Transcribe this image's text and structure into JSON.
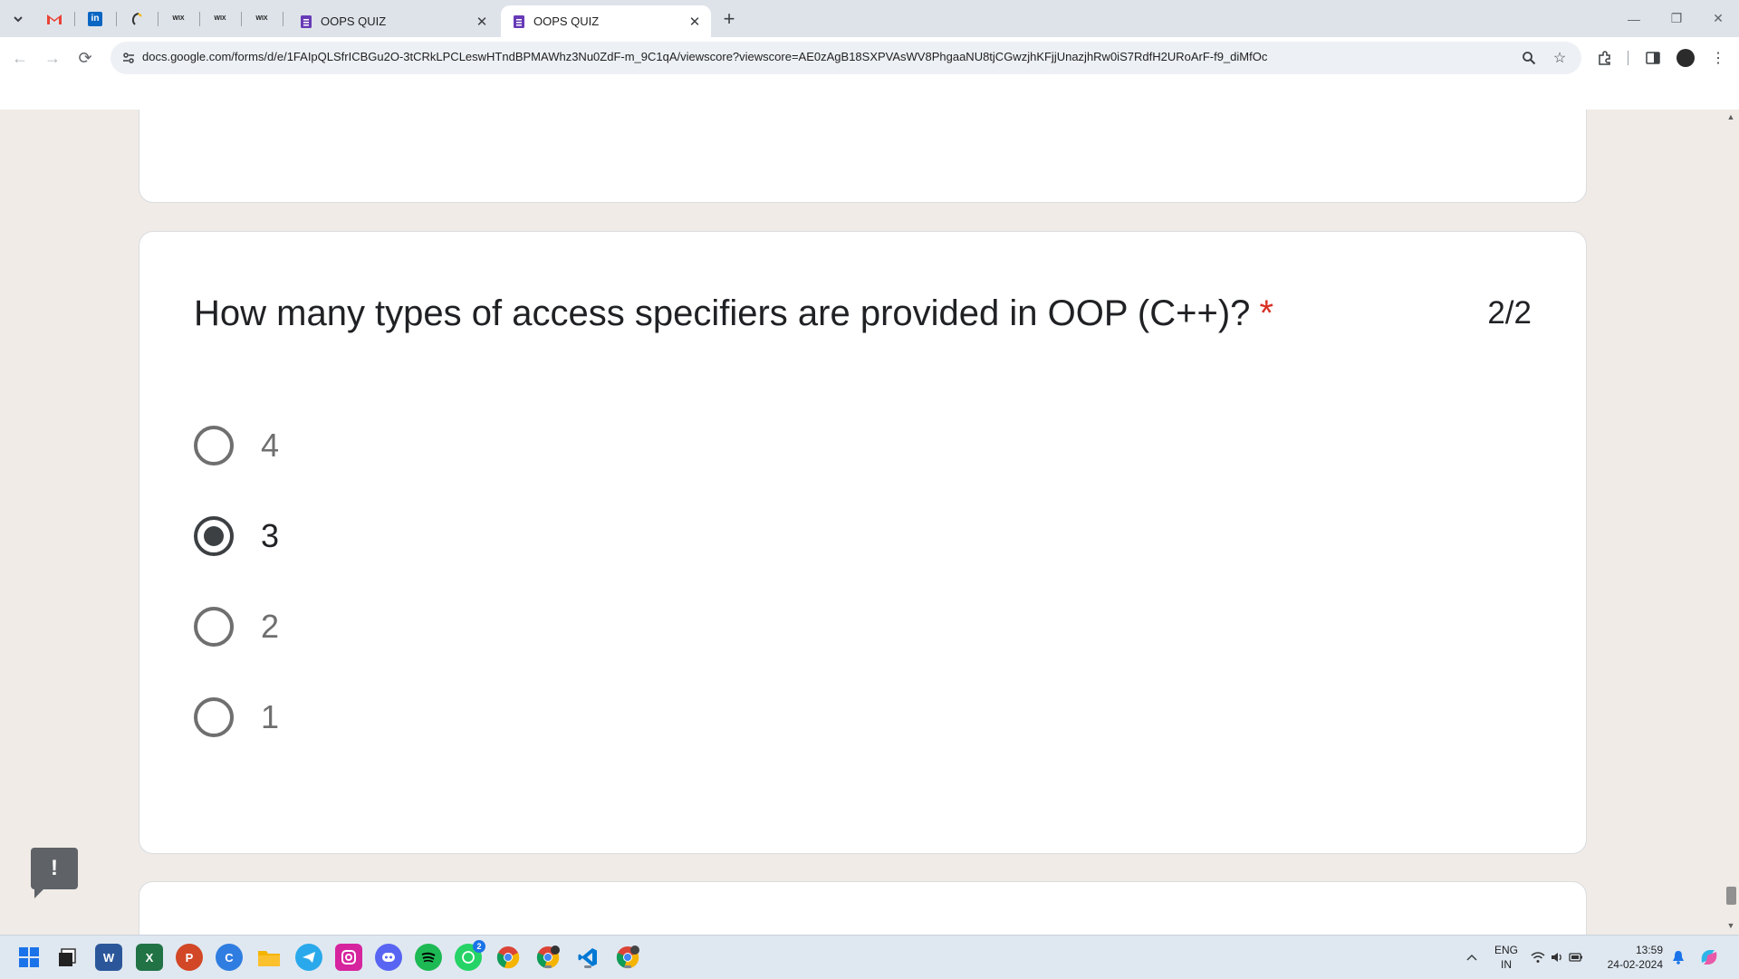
{
  "browser": {
    "tabs": [
      {
        "title": "OOPS QUIZ",
        "active": false
      },
      {
        "title": "OOPS QUIZ",
        "active": true
      }
    ],
    "pinned_tabs": [
      "gmail-icon",
      "linkedin-icon",
      "edit-icon",
      "wix-icon",
      "wix-icon",
      "wix-icon"
    ],
    "pinned_labels": {
      "wix": "WIX"
    },
    "new_tab": "+",
    "url": "docs.google.com/forms/d/e/1FAIpQLSfrICBGu2O-3tCRkLPCLeswHTndBPMAWhz3Nu0ZdF-m_9C1qA/viewscore?viewscore=AE0zAgB18SXPVAsWV8PhgaaNU8tjCGwzjhKFjjUnazjhRw0iS7RdfH2URoArF-f9_diMfOc"
  },
  "question": {
    "text": "How many types of access specifiers are provided in OOP (C++)?",
    "required_mark": "*",
    "score": "2/2",
    "options": [
      {
        "label": "4",
        "selected": false
      },
      {
        "label": "3",
        "selected": true
      },
      {
        "label": "2",
        "selected": false
      },
      {
        "label": "1",
        "selected": false
      }
    ]
  },
  "feedback": {
    "label": "!"
  },
  "taskbar": {
    "apps": [
      "windows-start-icon",
      "file-explorer-icon",
      "word-icon",
      "excel-icon",
      "powerpoint-icon",
      "canva-icon",
      "folder-icon",
      "telegram-icon",
      "instagram-icon",
      "discord-icon",
      "spotify-icon",
      "whatsapp-icon",
      "chrome-icon",
      "chrome-profile-icon",
      "vscode-icon",
      "chrome-profile-2-icon"
    ],
    "whatsapp_badge": "2",
    "language": "ENG",
    "region": "IN",
    "time": "13:59",
    "date": "24-02-2024"
  },
  "colors": {
    "accent": "#673ab7",
    "required": "#d93025",
    "page_bg": "#f0ebe6"
  }
}
